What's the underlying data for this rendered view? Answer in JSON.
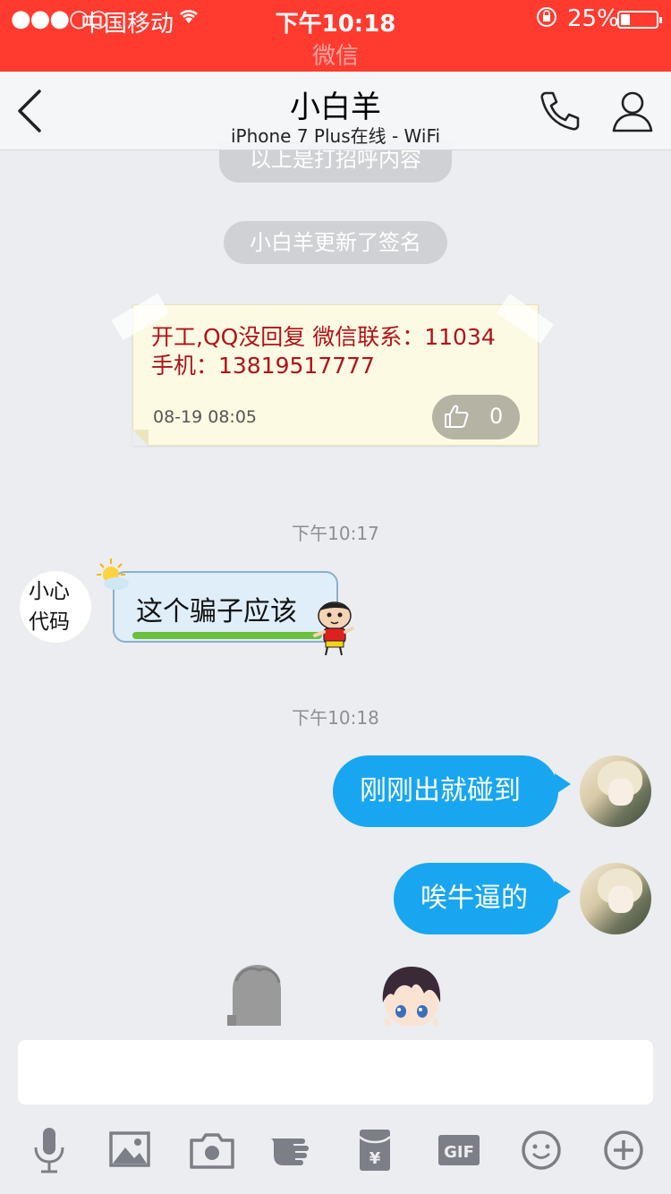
{
  "status_bar": {
    "signal": "●●●○○",
    "carrier": "中国移动",
    "time": "下午10:18",
    "battery_percent": "25%",
    "battery_level": 0.25,
    "app_hint": "微信"
  },
  "nav": {
    "title": "小白羊",
    "subtitle": "iPhone 7 Plus在线 - WiFi"
  },
  "system_messages": {
    "greeting": "以上是打招呼内容",
    "signature_update": "小白羊更新了签名"
  },
  "signature_card": {
    "content": "开工,QQ没回复 微信联系：11034 手机：13819517777",
    "date": "08-19 08:05",
    "like_count": "0"
  },
  "timestamps": [
    "下午10:17",
    "下午10:18"
  ],
  "incoming": {
    "avatar_text": "小心代码",
    "text": "这个骗子应该"
  },
  "outgoing": [
    {
      "text": "刚刚出就碰到"
    },
    {
      "text": "唉牛逼的"
    }
  ],
  "input": {
    "value": ""
  },
  "toolbar": [
    "microphone-icon",
    "image-icon",
    "camera-icon",
    "poke-icon",
    "red-packet-icon",
    "gif-icon",
    "emoji-icon",
    "plus-icon"
  ],
  "colors": {
    "status_bar": "#ff3b30",
    "outgoing_bubble": "#19a6f0",
    "note_text": "#b0121a",
    "background": "#ebedf0"
  }
}
